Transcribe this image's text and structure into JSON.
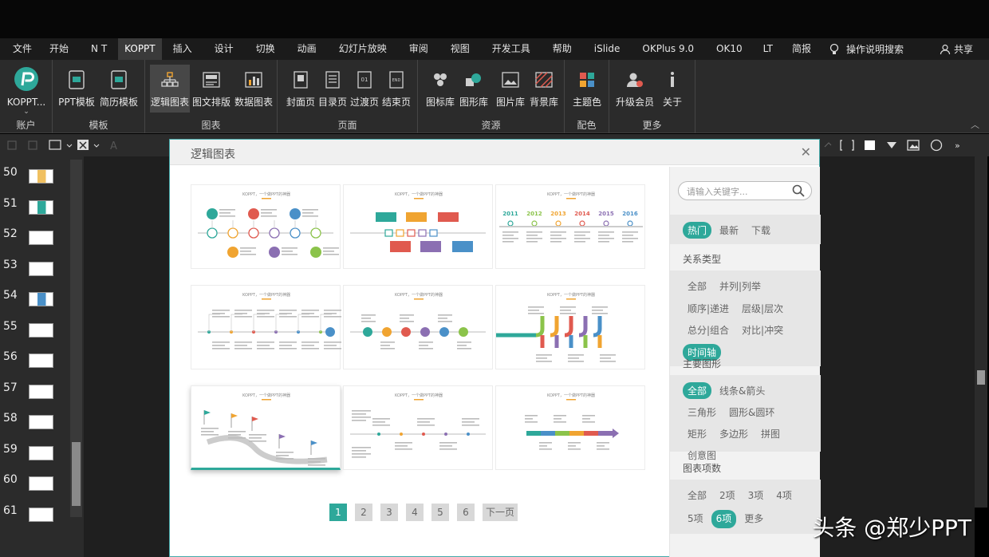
{
  "tabs": [
    "文件",
    "开始",
    "N T",
    "KOPPT",
    "插入",
    "设计",
    "切换",
    "动画",
    "幻灯片放映",
    "审阅",
    "视图",
    "开发工具",
    "帮助",
    "iSlide",
    "OKPlus 9.0",
    "OK10",
    "LT",
    "简报"
  ],
  "active_tab": "KOPPT",
  "tell_me": "操作说明搜索",
  "share": "共享",
  "ribbon": {
    "account": {
      "button": "KOPPT...",
      "group": "账户"
    },
    "template": {
      "buttons": [
        "PPT模板",
        "简历模板"
      ],
      "group": "模板"
    },
    "chart": {
      "buttons": [
        "逻辑图表",
        "图文排版",
        "数据图表"
      ],
      "group": "图表"
    },
    "page": {
      "buttons": [
        "封面页",
        "目录页",
        "过渡页",
        "结束页"
      ],
      "group": "页面"
    },
    "resource": {
      "buttons": [
        "图标库",
        "图形库",
        "图片库",
        "背景库"
      ],
      "group": "资源"
    },
    "color": {
      "buttons": [
        "主题色"
      ],
      "group": "配色"
    },
    "more": {
      "buttons": [
        "升级会员",
        "关于"
      ],
      "group": "更多"
    }
  },
  "slides": [
    "50",
    "51",
    "52",
    "53",
    "54",
    "55",
    "56",
    "57",
    "58",
    "59",
    "60",
    "61"
  ],
  "dialog": {
    "title": "逻辑图表",
    "search_placeholder": "请输入关键字...",
    "sort_tabs": [
      {
        "label": "热门",
        "on": true
      },
      {
        "label": "最新",
        "on": false
      },
      {
        "label": "下载",
        "on": false
      }
    ],
    "relation": {
      "title": "关系类型",
      "options": [
        {
          "label": "全部",
          "on": false
        },
        {
          "label": "并列|列举",
          "on": false
        },
        {
          "label": "顺序|递进",
          "on": false
        },
        {
          "label": "层级|层次",
          "on": false
        },
        {
          "label": "总分|组合",
          "on": false
        },
        {
          "label": "对比|冲突",
          "on": false
        },
        {
          "label": "时间轴",
          "on": true
        }
      ]
    },
    "shape": {
      "title": "主要图形",
      "options": [
        {
          "label": "全部",
          "on": true
        },
        {
          "label": "线条&箭头",
          "on": false
        },
        {
          "label": "三角形",
          "on": false
        },
        {
          "label": "圆形&圆环",
          "on": false
        },
        {
          "label": "矩形",
          "on": false
        },
        {
          "label": "多边形",
          "on": false
        },
        {
          "label": "拼图",
          "on": false
        },
        {
          "label": "创意图",
          "on": false
        }
      ]
    },
    "count": {
      "title": "图表项数",
      "options": [
        {
          "label": "全部",
          "on": false
        },
        {
          "label": "2项",
          "on": false
        },
        {
          "label": "3项",
          "on": false
        },
        {
          "label": "4项",
          "on": false
        },
        {
          "label": "5项",
          "on": false
        },
        {
          "label": "6项",
          "on": true
        },
        {
          "label": "更多",
          "on": false
        }
      ]
    },
    "pages": [
      "1",
      "2",
      "3",
      "4",
      "5",
      "6"
    ],
    "active_page": "1",
    "next": "下一页",
    "card_header": "KOPPT，一个做PPT的神器",
    "years": [
      "2011",
      "2012",
      "2013",
      "2014",
      "2015",
      "2016"
    ]
  },
  "watermark": "头条 @郑少PPT",
  "colors": {
    "accent": "#2ea89a",
    "teal": "#2ea89a",
    "orange": "#f0a431",
    "red": "#e05a4f",
    "purple": "#8b6fb2",
    "blue": "#4a90c8",
    "green": "#8bc34a"
  }
}
